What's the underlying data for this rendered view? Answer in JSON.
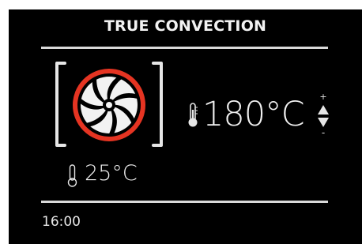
{
  "display": {
    "mode_title": "TRUE CONVECTION",
    "mode_icon": "convection-fan-icon",
    "setpoint_temp": "180°C",
    "current_temp": "25°C",
    "clock": "16:00",
    "adjust_plus": "+",
    "adjust_minus": "-"
  },
  "colors": {
    "background": "#000000",
    "text": "#ffffff",
    "accent_ring": "#e53422"
  }
}
